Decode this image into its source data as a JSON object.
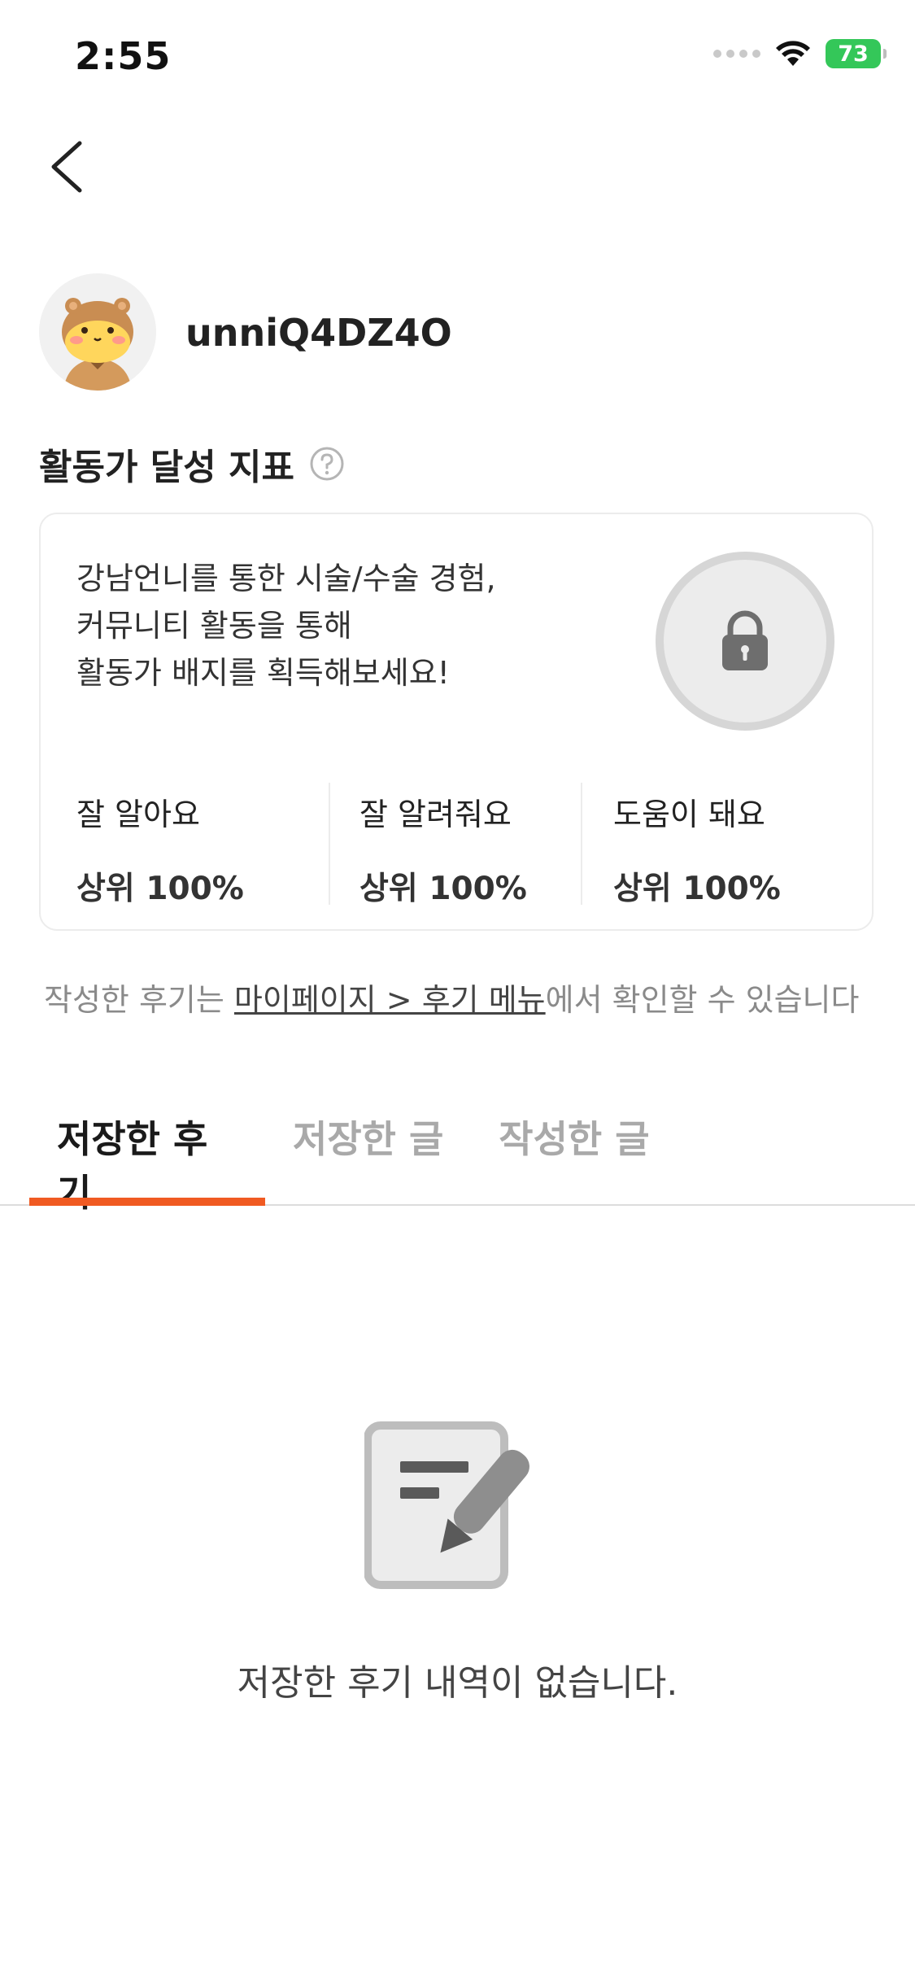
{
  "status_bar": {
    "time": "2:55",
    "battery": "73"
  },
  "profile": {
    "username": "unniQ4DZ4O"
  },
  "section": {
    "title": "활동가 달성 지표"
  },
  "card": {
    "desc_lines": [
      "강남언니를 통한 시술/수술 경험,",
      "커뮤니티 활동을 통해",
      "활동가 배지를 획득해보세요!"
    ],
    "stats": [
      {
        "label": "잘 알아요",
        "value": "상위 100%"
      },
      {
        "label": "잘 알려줘요",
        "value": "상위 100%"
      },
      {
        "label": "도움이 돼요",
        "value": "상위 100%"
      }
    ]
  },
  "notice": {
    "prefix": "작성한 후기는 ",
    "link": "마이페이지 > 후기 메뉴",
    "suffix": "에서 확인할 수 있습니다"
  },
  "tabs": [
    {
      "label": "저장한 후기",
      "active": true
    },
    {
      "label": "저장한 글",
      "active": false
    },
    {
      "label": "작성한 글",
      "active": false
    }
  ],
  "empty_state": {
    "text": "저장한 후기 내역이 없습니다."
  },
  "colors": {
    "accent": "#f05a22",
    "battery": "#34c759"
  }
}
